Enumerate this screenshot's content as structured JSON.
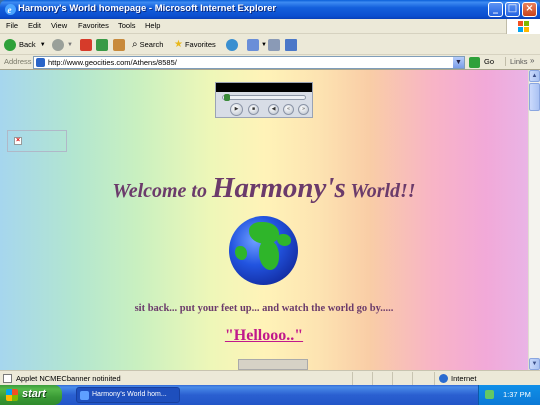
{
  "window": {
    "title": "Harmony's World homepage - Microsoft Internet Explorer"
  },
  "menu": [
    "File",
    "Edit",
    "View",
    "Favorites",
    "Tools",
    "Help"
  ],
  "toolbar": {
    "back_label": "Back",
    "search_label": "Search",
    "favorites_label": "Favorites"
  },
  "address": {
    "label": "Address",
    "url": "http://www.geocities.com/Athens/8585/",
    "go_label": "Go",
    "links_label": "Links"
  },
  "page": {
    "welcome_pre": "Welcome to ",
    "welcome_big": "Harmony's",
    "welcome_post": " World!!",
    "tagline": "sit back... put your feet up... and watch the world go by.....",
    "hello_link": "\"Hellooo..\""
  },
  "status": {
    "message": "Applet NCMECbanner notinited",
    "zone": "Internet"
  },
  "taskbar": {
    "start_label": "start",
    "task_label": "Harmony's World hom...",
    "clock": "1:37 PM"
  },
  "colors": {
    "accent_text": "#6b3b6b",
    "link": "#c0188c",
    "titlebar": "#0b4fd0"
  }
}
